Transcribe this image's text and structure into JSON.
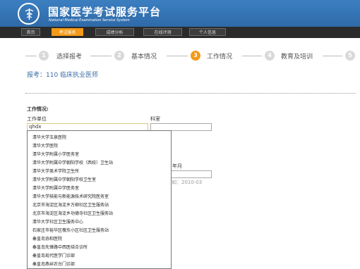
{
  "header": {
    "title": "国家医学考试服务平台",
    "subtitle": "National Medical Examination Service System"
  },
  "nav": {
    "items": [
      {
        "label": "首页",
        "active": false
      },
      {
        "label": "考试报名",
        "active": true
      },
      {
        "label": "成绩分析",
        "active": false
      },
      {
        "label": "在线评测",
        "active": false
      },
      {
        "label": "个人信息",
        "active": false
      }
    ]
  },
  "steps": [
    {
      "num": "1",
      "label": "选择报考",
      "active": false
    },
    {
      "num": "2",
      "label": "基本情况",
      "active": false
    },
    {
      "num": "3",
      "label": "工作情况",
      "active": true
    },
    {
      "num": "4",
      "label": "教育及培训",
      "active": false
    },
    {
      "num": "5",
      "label": "",
      "active": false
    }
  ],
  "exam_info": "报考：110 临床执业医师",
  "form": {
    "section_title": "工作情况:",
    "work_unit_label": "工作单位",
    "work_unit_value": "qhdx",
    "dept_label": "科室",
    "year_month_label": "年月",
    "date_hint": "如：2010-03"
  },
  "suggestions": [
    "清华大学玉泉医院",
    "清华大学医院",
    "清华大学附属小学医务室",
    "清华大学附属中学朝阳学校（西校）卫生站",
    "清华大学美术学院卫生所",
    "清华大学附属中学朝阳学校卫生室",
    "清华大学附属中学医务室",
    "清华大学核能与新能源技术研究院医务室",
    "北京市海淀区海淀乡万柳社区卫生服务站",
    "北京市海淀区海淀乡功德寺社区卫生服务站",
    "清华大学社区卫生服务中心",
    "石家庄市裕华区槐东小区社区卫生服务站",
    "秦皇岛协和医院",
    "秦皇岛先锋路中西医结合诊所",
    "秦皇岛现代医学门诊部",
    "秦皇岛燕丝农台门诊部"
  ]
}
